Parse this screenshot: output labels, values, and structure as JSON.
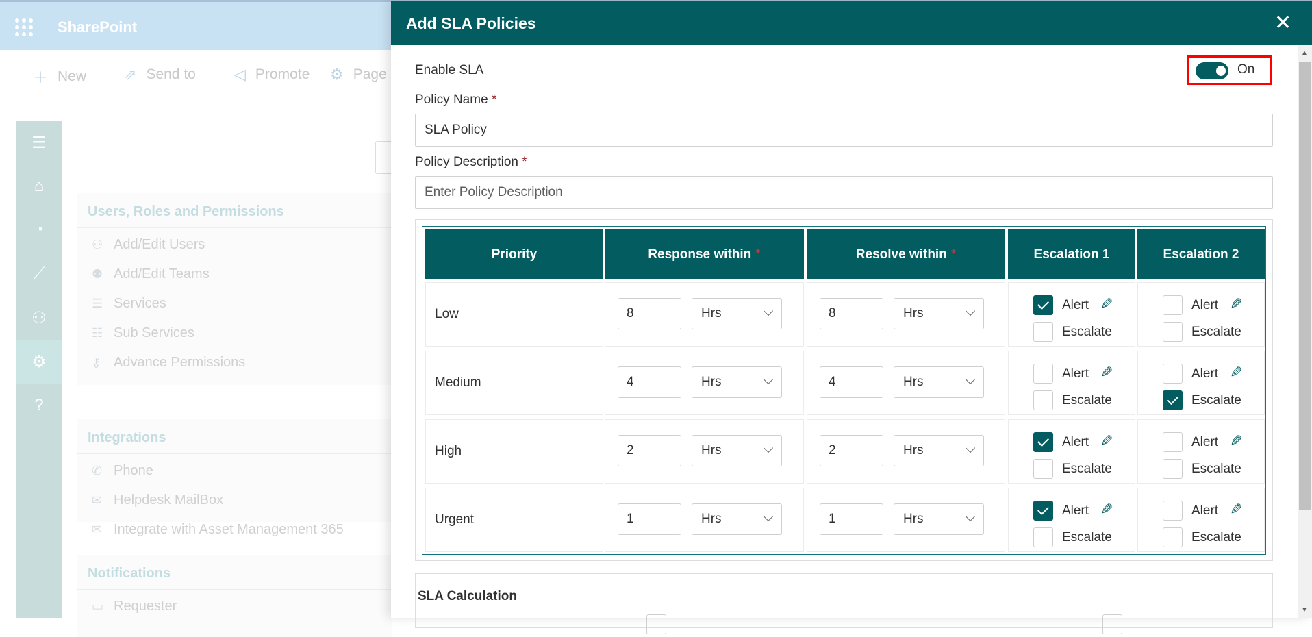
{
  "background": {
    "app_title": "SharePoint",
    "command_bar": [
      {
        "icon": "plus-icon",
        "label": "New"
      },
      {
        "icon": "send-icon",
        "label": "Send to"
      },
      {
        "icon": "megaphone-icon",
        "label": "Promote"
      },
      {
        "icon": "gear-icon",
        "label": "Page"
      }
    ],
    "rail": [
      "menu-icon",
      "home-icon",
      "dashboard-icon",
      "chart-icon",
      "user-group-icon",
      "gear-icon",
      "help-icon"
    ],
    "sections": [
      {
        "title": "Users, Roles and Permissions",
        "items": [
          {
            "icon": "users-icon",
            "label": "Add/Edit Users"
          },
          {
            "icon": "teams-icon",
            "label": "Add/Edit Teams"
          },
          {
            "icon": "list-icon",
            "label": "Services"
          },
          {
            "icon": "sublist-icon",
            "label": "Sub Services"
          },
          {
            "icon": "key-icon",
            "label": "Advance Permissions"
          }
        ]
      },
      {
        "title": "Integrations",
        "items": [
          {
            "icon": "phone-icon",
            "label": "Phone"
          },
          {
            "icon": "mail-icon",
            "label": "Helpdesk MailBox"
          },
          {
            "icon": "mail-settings-icon",
            "label": "Integrate with Asset Management 365"
          }
        ]
      },
      {
        "title": "Notifications",
        "items": [
          {
            "icon": "comment-icon",
            "label": "Requester"
          }
        ]
      }
    ]
  },
  "dialog": {
    "title": "Add SLA Policies",
    "enable_label": "Enable SLA",
    "toggle": {
      "state": true,
      "label": "On"
    },
    "policy_name_label": "Policy Name",
    "policy_name_value": "SLA Policy",
    "policy_desc_label": "Policy Description",
    "policy_desc_placeholder": "Enter Policy Description",
    "required_mark": "*",
    "accent_color": "#035c60",
    "table": {
      "headers": [
        "Priority",
        "Response within",
        "Resolve within",
        "Escalation 1",
        "Escalation 2"
      ],
      "alert_label": "Alert",
      "escalate_label": "Escalate",
      "rows": [
        {
          "priority": "Low",
          "response": "8",
          "response_unit": "Hrs",
          "resolve": "8",
          "resolve_unit": "Hrs",
          "e1_alert": true,
          "e1_escalate": false,
          "e2_alert": false,
          "e2_escalate": false
        },
        {
          "priority": "Medium",
          "response": "4",
          "response_unit": "Hrs",
          "resolve": "4",
          "resolve_unit": "Hrs",
          "e1_alert": false,
          "e1_escalate": false,
          "e2_alert": false,
          "e2_escalate": true
        },
        {
          "priority": "High",
          "response": "2",
          "response_unit": "Hrs",
          "resolve": "2",
          "resolve_unit": "Hrs",
          "e1_alert": true,
          "e1_escalate": false,
          "e2_alert": false,
          "e2_escalate": false
        },
        {
          "priority": "Urgent",
          "response": "1",
          "response_unit": "Hrs",
          "resolve": "1",
          "resolve_unit": "Hrs",
          "e1_alert": true,
          "e1_escalate": false,
          "e2_alert": false,
          "e2_escalate": false
        }
      ]
    },
    "sla_calc_label": "SLA Calculation"
  }
}
